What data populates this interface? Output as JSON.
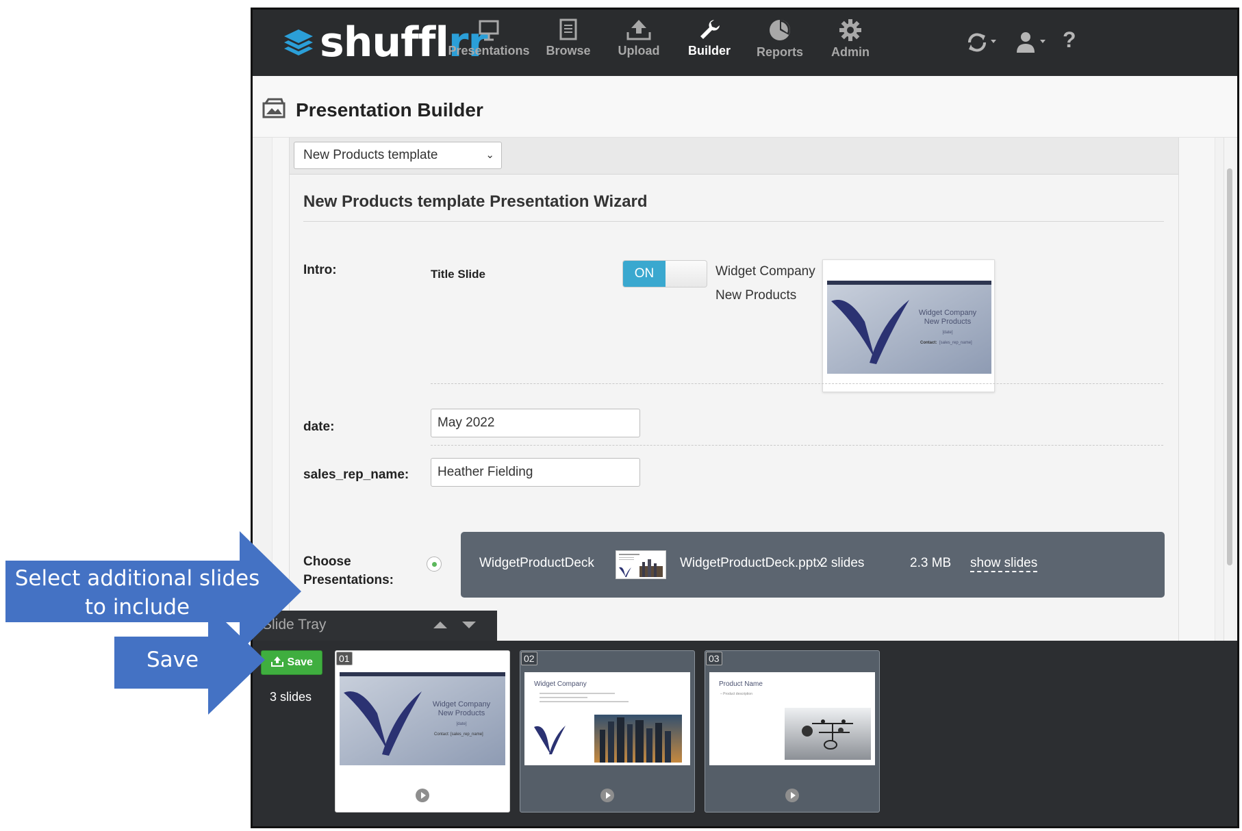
{
  "app": {
    "logo": {
      "main": "shuffl",
      "accent": "rr"
    },
    "nav": [
      {
        "label": "Presentations",
        "icon": "presentation-easel-icon"
      },
      {
        "label": "Browse",
        "icon": "browse-document-icon"
      },
      {
        "label": "Upload",
        "icon": "upload-icon"
      },
      {
        "label": "Builder",
        "icon": "wrench-icon",
        "active": true
      },
      {
        "label": "Reports",
        "icon": "pie-chart-icon"
      },
      {
        "label": "Admin",
        "icon": "gear-icon"
      }
    ],
    "nav_right": {
      "sync": "sync-icon",
      "user": "user-icon",
      "help": "?"
    }
  },
  "page": {
    "title": "Presentation Builder"
  },
  "builder": {
    "template_select": "New Products template",
    "wizard_title": "New Products template Presentation Wizard",
    "intro": {
      "label": "Intro:",
      "slide_label": "Title Slide",
      "toggle": "ON",
      "line1": "Widget Company",
      "line2": "New Products",
      "thumb": {
        "title1": "Widget Company",
        "title2": "New Products",
        "date": "[date]",
        "contact_label": "Contact:",
        "contact_value": "[sales_rep_name]"
      }
    },
    "date": {
      "label": "date:",
      "value": "May 2022"
    },
    "sales_rep": {
      "label": "sales_rep_name:",
      "value": "Heather Fielding"
    },
    "choose": {
      "label_line1": "Choose",
      "label_line2": "Presentations:",
      "deck_name": "WidgetProductDeck",
      "file_name": "WidgetProductDeck.pptx",
      "slides": "2 slides",
      "size": "2.3 MB",
      "show_slides": "show slides"
    }
  },
  "tray": {
    "title": "Slide Tray",
    "save": "Save",
    "count": "3 slides",
    "slides": [
      {
        "num": "01",
        "title1": "Widget Company",
        "title2": "New Products",
        "date": "[date]",
        "contact": "Contact: [sales_rep_name]"
      },
      {
        "num": "02",
        "title": "Widget Company"
      },
      {
        "num": "03",
        "title": "Product Name",
        "sub": "– Product description"
      }
    ]
  },
  "callouts": {
    "select": {
      "line1": "Select additional slides",
      "line2": "to include"
    },
    "save": "Save"
  },
  "colors": {
    "nav_bg": "#2a2c2e",
    "brand_blue": "#2b9fd8",
    "toggle_on": "#3aa8cf",
    "save_green": "#3fae3f",
    "deck_row": "#5c6570",
    "callout_blue": "#4472c4"
  }
}
